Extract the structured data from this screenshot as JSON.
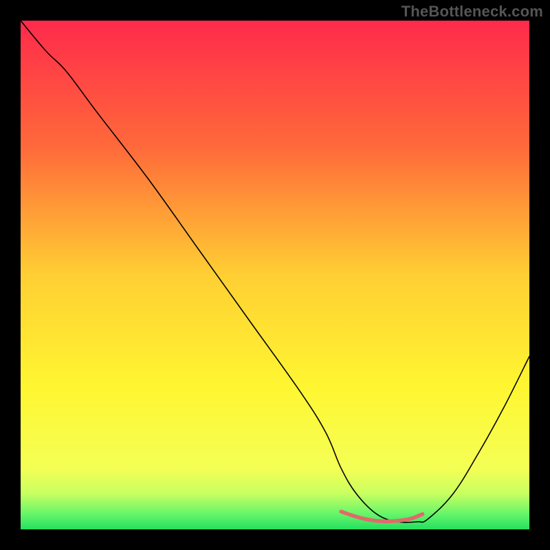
{
  "watermark": "TheBottleneck.com",
  "chart_data": {
    "type": "line",
    "title": "",
    "xlabel": "",
    "ylabel": "",
    "xlim": [
      0,
      100
    ],
    "ylim": [
      0,
      100
    ],
    "background_gradient": {
      "stops": [
        {
          "offset": 0.0,
          "color": "#ff2a4b"
        },
        {
          "offset": 0.25,
          "color": "#ff6a3a"
        },
        {
          "offset": 0.5,
          "color": "#ffcf33"
        },
        {
          "offset": 0.72,
          "color": "#fff631"
        },
        {
          "offset": 0.88,
          "color": "#f4ff55"
        },
        {
          "offset": 0.93,
          "color": "#c8ff60"
        },
        {
          "offset": 0.97,
          "color": "#66f56a"
        },
        {
          "offset": 1.0,
          "color": "#23e060"
        }
      ]
    },
    "series": [
      {
        "name": "bottleneck-curve",
        "color": "#000000",
        "width": 1.6,
        "x": [
          0,
          5,
          9,
          15,
          25,
          35,
          45,
          55,
          60,
          63,
          66,
          70,
          74,
          78,
          80,
          85,
          90,
          95,
          100
        ],
        "y": [
          100,
          94,
          90,
          82,
          69,
          55,
          41,
          27,
          19,
          12,
          7,
          3,
          1.5,
          1.5,
          2,
          7,
          15,
          24,
          34
        ]
      },
      {
        "name": "trough-highlight",
        "color": "#e06a6a",
        "width": 5.5,
        "x": [
          63,
          65,
          67,
          69,
          71,
          73,
          75,
          77,
          79
        ],
        "y": [
          3.5,
          2.8,
          2.2,
          1.8,
          1.6,
          1.6,
          1.8,
          2.2,
          3.0
        ]
      }
    ],
    "annotations": []
  }
}
